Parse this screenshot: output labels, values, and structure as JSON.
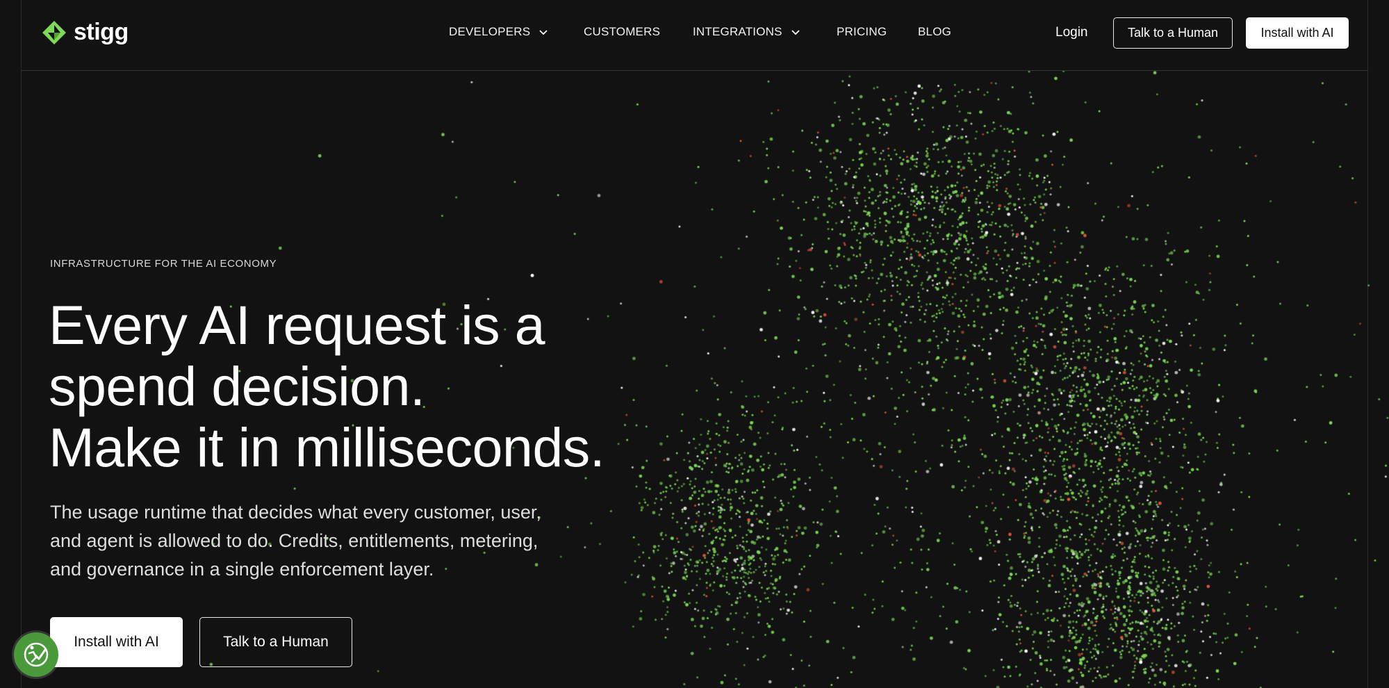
{
  "brand": {
    "name": "stigg",
    "icon": "stigg-logo-icon",
    "accent": "#7dd957"
  },
  "nav": {
    "items": [
      {
        "label": "DEVELOPERS",
        "has_dropdown": true
      },
      {
        "label": "CUSTOMERS",
        "has_dropdown": false
      },
      {
        "label": "INTEGRATIONS",
        "has_dropdown": true
      },
      {
        "label": "PRICING",
        "has_dropdown": false
      },
      {
        "label": "BLOG",
        "has_dropdown": false
      }
    ],
    "login_label": "Login",
    "talk_label": "Talk to a Human",
    "install_label": "Install with AI"
  },
  "hero": {
    "eyebrow": "INFRASTRUCTURE FOR THE AI ECONOMY",
    "headline": [
      "Every AI request is a",
      "spend decision.",
      "Make it in milliseconds."
    ],
    "subtitle": [
      "The usage runtime that decides what every customer, user,",
      "and agent is allowed to do. Credits, entitlements, metering,",
      "and governance in a single enforcement layer."
    ],
    "primary_cta": "Install with AI",
    "secondary_cta": "Talk to a Human"
  },
  "accessibility_widget": {
    "icon": "accessibility-icon"
  },
  "colors": {
    "background": "#111211",
    "particle_green": "#7dd957",
    "particle_white": "#ffffff",
    "particle_red": "#e2553a"
  }
}
